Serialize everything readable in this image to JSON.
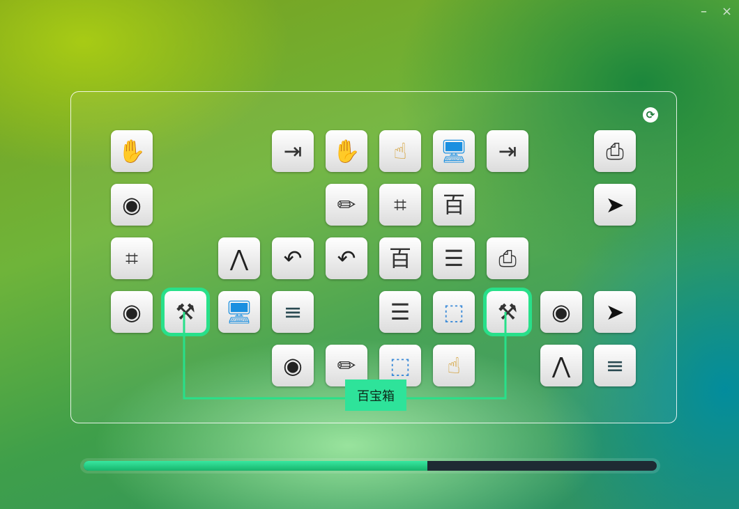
{
  "window": {
    "minimize_label": "–",
    "close_label": "×"
  },
  "board": {
    "refresh_icon": "refresh-icon",
    "link_label": "百宝箱",
    "highlight_color": "#28e08a"
  },
  "tiles": [
    {
      "row": 0,
      "col": 0,
      "icon": "hand-icon",
      "glyph": "✋",
      "color": "#777777"
    },
    {
      "row": 0,
      "col": 3,
      "icon": "exit-icon",
      "glyph": "⇥",
      "color": "#333333"
    },
    {
      "row": 0,
      "col": 4,
      "icon": "hand-icon",
      "glyph": "✋",
      "color": "#777777"
    },
    {
      "row": 0,
      "col": 5,
      "icon": "eraser-hand-icon",
      "glyph": "☝",
      "color": "#d19a2a"
    },
    {
      "row": 0,
      "col": 6,
      "icon": "monitor-icon",
      "glyph": "🖥",
      "color": "#1a8fe0"
    },
    {
      "row": 0,
      "col": 7,
      "icon": "exit-icon",
      "glyph": "⇥",
      "color": "#333333"
    },
    {
      "row": 0,
      "col": 9,
      "icon": "tray-icon",
      "glyph": "⎙",
      "color": "#333333"
    },
    {
      "row": 1,
      "col": 0,
      "icon": "spotlight-icon",
      "glyph": "◉",
      "color": "#222222"
    },
    {
      "row": 1,
      "col": 4,
      "icon": "pencil-icon",
      "glyph": "✏",
      "color": "#333333"
    },
    {
      "row": 1,
      "col": 5,
      "icon": "crop-icon",
      "glyph": "⌗",
      "color": "#333333"
    },
    {
      "row": 1,
      "col": 6,
      "icon": "calligraphy-icon",
      "glyph": "百",
      "color": "#333333"
    },
    {
      "row": 1,
      "col": 9,
      "icon": "cursor-icon",
      "glyph": "➤",
      "color": "#111111"
    },
    {
      "row": 2,
      "col": 0,
      "icon": "crop-icon",
      "glyph": "⌗",
      "color": "#333333"
    },
    {
      "row": 2,
      "col": 2,
      "icon": "nodes-icon",
      "glyph": "⋀",
      "color": "#222222"
    },
    {
      "row": 2,
      "col": 3,
      "icon": "undo-icon",
      "glyph": "↶",
      "color": "#222222"
    },
    {
      "row": 2,
      "col": 4,
      "icon": "undo-icon",
      "glyph": "↶",
      "color": "#222222"
    },
    {
      "row": 2,
      "col": 5,
      "icon": "calligraphy-icon",
      "glyph": "百",
      "color": "#333333"
    },
    {
      "row": 2,
      "col": 6,
      "icon": "list-icon",
      "glyph": "☰",
      "color": "#333333"
    },
    {
      "row": 2,
      "col": 7,
      "icon": "tray-icon",
      "glyph": "⎙",
      "color": "#333333"
    },
    {
      "row": 3,
      "col": 0,
      "icon": "spotlight-icon",
      "glyph": "◉",
      "color": "#222222"
    },
    {
      "row": 3,
      "col": 1,
      "icon": "toolbox-icon",
      "glyph": "⚒",
      "color": "#333333",
      "selected": true
    },
    {
      "row": 3,
      "col": 2,
      "icon": "monitor-icon",
      "glyph": "🖥",
      "color": "#1a8fe0"
    },
    {
      "row": 3,
      "col": 3,
      "icon": "menu-icon",
      "glyph": "≡",
      "color": "#2a4a52"
    },
    {
      "row": 3,
      "col": 5,
      "icon": "list-icon",
      "glyph": "☰",
      "color": "#333333"
    },
    {
      "row": 3,
      "col": 6,
      "icon": "screenshot-icon",
      "glyph": "⬚",
      "color": "#3a8ad8"
    },
    {
      "row": 3,
      "col": 7,
      "icon": "toolbox-icon",
      "glyph": "⚒",
      "color": "#333333",
      "selected": true
    },
    {
      "row": 3,
      "col": 8,
      "icon": "spotlight-icon",
      "glyph": "◉",
      "color": "#222222"
    },
    {
      "row": 3,
      "col": 9,
      "icon": "cursor-icon",
      "glyph": "➤",
      "color": "#111111"
    },
    {
      "row": 4,
      "col": 3,
      "icon": "spotlight-icon",
      "glyph": "◉",
      "color": "#222222"
    },
    {
      "row": 4,
      "col": 4,
      "icon": "pencil-icon",
      "glyph": "✏",
      "color": "#333333"
    },
    {
      "row": 4,
      "col": 5,
      "icon": "screenshot-icon",
      "glyph": "⬚",
      "color": "#3a8ad8"
    },
    {
      "row": 4,
      "col": 6,
      "icon": "eraser-hand-icon",
      "glyph": "☝",
      "color": "#d19a2a"
    },
    {
      "row": 4,
      "col": 8,
      "icon": "nodes-icon",
      "glyph": "⋀",
      "color": "#222222"
    },
    {
      "row": 4,
      "col": 9,
      "icon": "menu-icon",
      "glyph": "≡",
      "color": "#2a4a52"
    }
  ],
  "progress": {
    "fraction": 0.6,
    "fill_color": "#2ed38a"
  }
}
